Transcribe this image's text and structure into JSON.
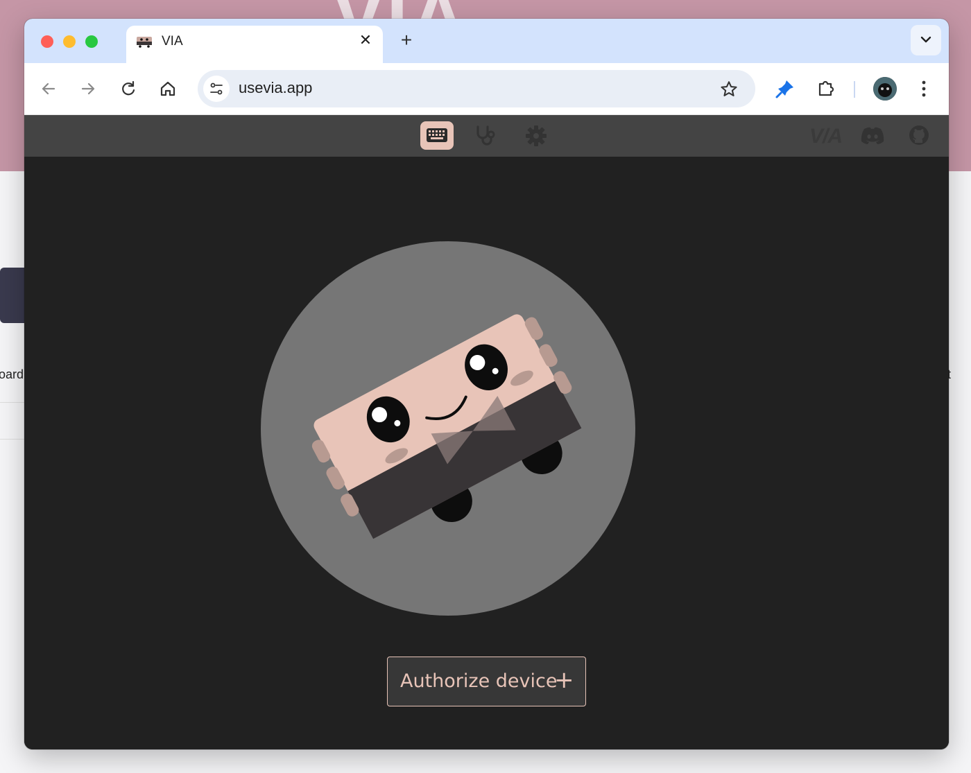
{
  "browser": {
    "tab_title": "VIA",
    "url": "usevia.app",
    "icons": {
      "back": "arrow-left-icon",
      "forward": "arrow-right-icon",
      "reload": "reload-icon",
      "home": "home-icon",
      "site_info": "tune-icon",
      "bookmark": "star-icon",
      "extension_pin": "pin-icon",
      "extensions": "puzzle-icon",
      "menu": "more-vert-icon",
      "close_tab": "close-icon",
      "new_tab": "plus-icon",
      "tab_search": "chevron-down-icon"
    }
  },
  "app": {
    "nav": [
      "keyboard-icon",
      "stethoscope-icon",
      "gear-icon"
    ],
    "brand": "V/A",
    "links": [
      "discord-icon",
      "github-icon"
    ],
    "authorize_label": "Authorize device",
    "authorize_icon": "+"
  },
  "background": {
    "left_fragment": "oard.",
    "right_fragment": "t"
  },
  "colors": {
    "accent": "#e8c4b8",
    "app_header": "#444444",
    "app_bg": "#212121",
    "chrome_tabbar": "#d3e3fd"
  }
}
